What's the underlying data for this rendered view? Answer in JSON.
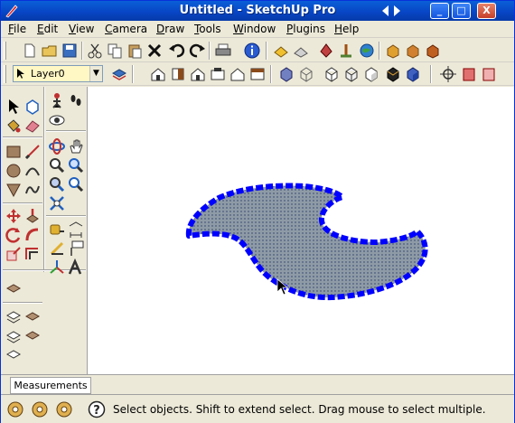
{
  "window": {
    "title": "Untitled - SketchUp Pro",
    "controls": {
      "minimize": "_",
      "maximize": "□",
      "close": "X"
    }
  },
  "menu": [
    {
      "label": "File",
      "accel": "F",
      "rest": "ile"
    },
    {
      "label": "Edit",
      "accel": "E",
      "rest": "dit"
    },
    {
      "label": "View",
      "accel": "V",
      "rest": "iew"
    },
    {
      "label": "Camera",
      "accel": "C",
      "rest": "amera"
    },
    {
      "label": "Draw",
      "accel": "D",
      "rest": "raw"
    },
    {
      "label": "Tools",
      "accel": "T",
      "rest": "ools"
    },
    {
      "label": "Window",
      "accel": "W",
      "rest": "indow"
    },
    {
      "label": "Plugins",
      "accel": "P",
      "rest": "lugins"
    },
    {
      "label": "Help",
      "accel": "H",
      "rest": "elp"
    }
  ],
  "layer": {
    "current": "Layer0"
  },
  "measurements": {
    "label": "Measurements"
  },
  "status": {
    "text": "Select objects. Shift to extend select. Drag mouse to select multiple."
  },
  "colors": {
    "selection": "#0000ff",
    "face": "#8e9ba6",
    "titlebar": "#0846c6",
    "layer_bg": "#fff7c4"
  }
}
